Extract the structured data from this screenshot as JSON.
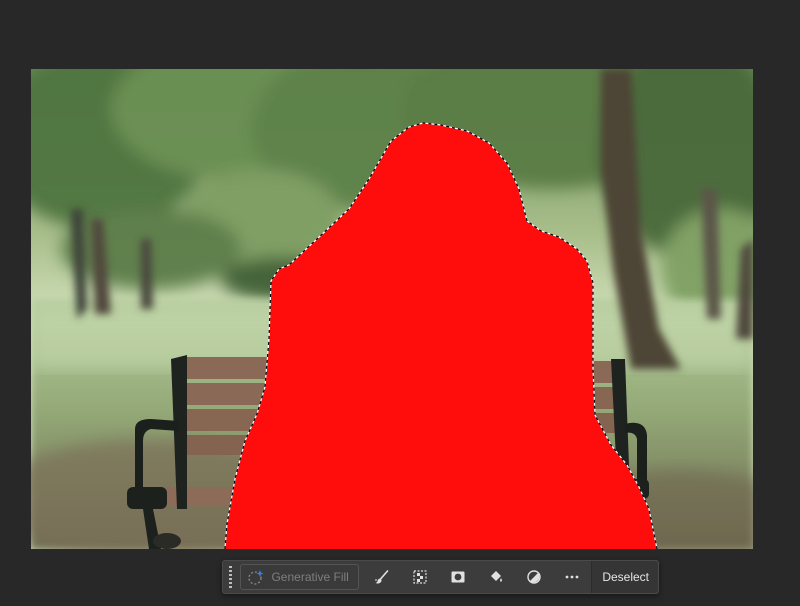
{
  "taskbar": {
    "generative_fill_label": "Generative Fill",
    "deselect_label": "Deselect",
    "tools": [
      {
        "icon": "brush-refine-icon"
      },
      {
        "icon": "select-subject-icon"
      },
      {
        "icon": "mask-icon"
      },
      {
        "icon": "paint-bucket-icon"
      },
      {
        "icon": "adjustment-icon"
      },
      {
        "icon": "more-icon"
      }
    ]
  },
  "colors": {
    "selection_fill": "#ff0c0c",
    "workspace_bg": "#282828",
    "taskbar_bg": "#3c3c3c"
  }
}
